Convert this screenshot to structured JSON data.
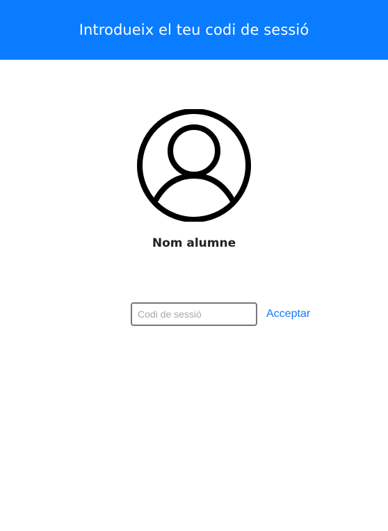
{
  "header": {
    "title": "Introdueix el teu codi de sessió"
  },
  "profile": {
    "icon": "user-avatar-icon",
    "name": "Nom alumne"
  },
  "session_form": {
    "code_placeholder": "Codi de sessió",
    "code_value": "",
    "accept_label": "Acceptar"
  },
  "colors": {
    "header_background": "#0a7cff",
    "accent": "#0a7cff"
  }
}
